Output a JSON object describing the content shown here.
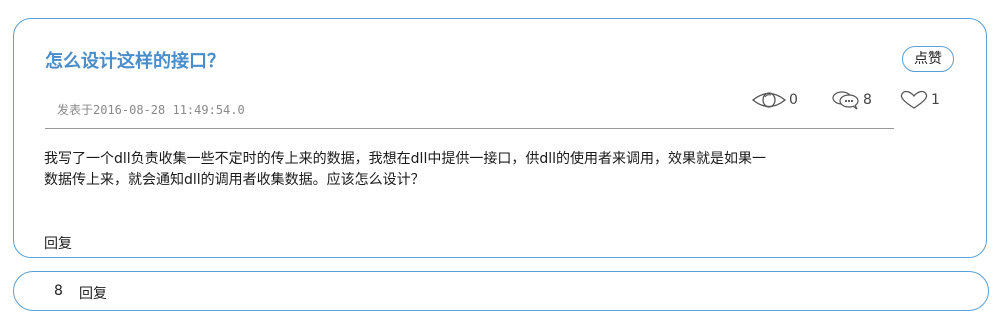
{
  "post": {
    "title": "怎么设计这样的接口？",
    "like_button_label": "点赞",
    "meta": "发表于2016-08-28 11:49:54.0",
    "stats": {
      "views": "0",
      "comments": "8",
      "likes": "1",
      "views_icon": "eye-icon",
      "comments_icon": "chat-bubbles-icon",
      "likes_icon": "heart-icon"
    },
    "body_line1": "我写了一个dll负责收集一些不定时的传上来的数据，我想在dll中提供一接口，供dll的使用者来调用，效果就是如果一",
    "body_line2": "数据传上来，就会通知dll的调用者收集数据。应该怎么设计？",
    "reply_label": "回复"
  },
  "replies": {
    "count": "8",
    "label": "回复"
  },
  "colors": {
    "accent": "#5aa0d6",
    "title": "#4a8dc8"
  }
}
